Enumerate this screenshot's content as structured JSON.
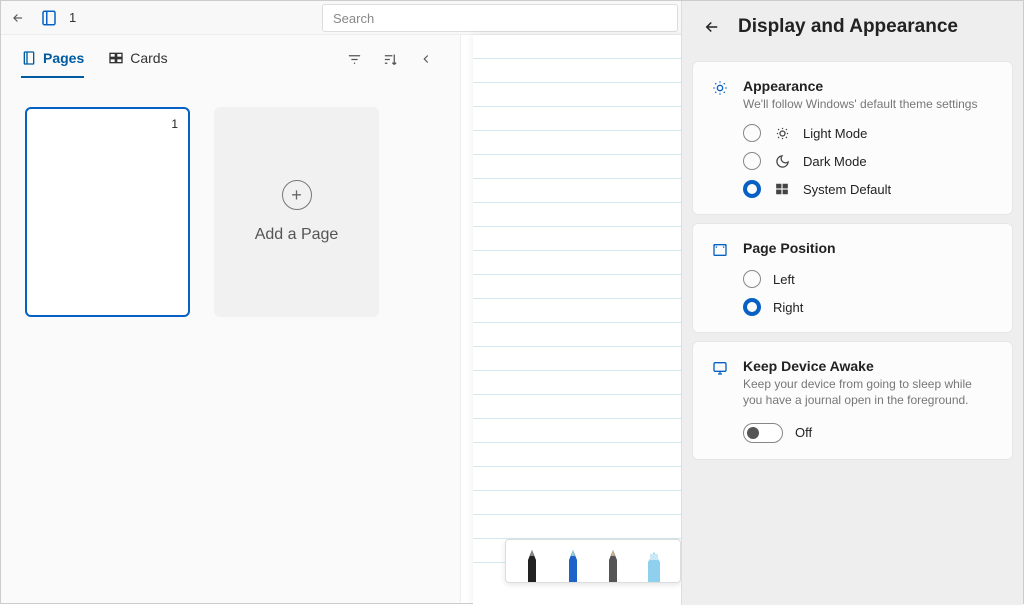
{
  "titlebar": {
    "doc_title": "1"
  },
  "search": {
    "placeholder": "Search"
  },
  "tabs": {
    "pages": "Pages",
    "cards": "Cards"
  },
  "thumbs": {
    "page1_num": "1",
    "add_label": "Add a Page"
  },
  "settings": {
    "title": "Display and Appearance",
    "appearance": {
      "title": "Appearance",
      "subtitle": "We'll follow Windows' default theme settings",
      "light": "Light Mode",
      "dark": "Dark Mode",
      "system": "System Default"
    },
    "pageposition": {
      "title": "Page Position",
      "left": "Left",
      "right": "Right"
    },
    "awake": {
      "title": "Keep Device Awake",
      "subtitle": "Keep your device from going to sleep while you have a journal open in the foreground.",
      "state": "Off"
    }
  }
}
